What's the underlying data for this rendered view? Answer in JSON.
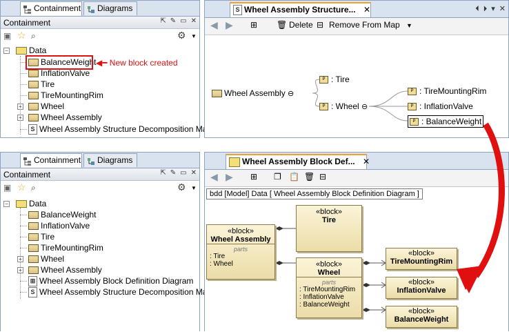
{
  "top": {
    "left_panel": {
      "tabs": [
        {
          "label": "Containment",
          "active": true
        },
        {
          "label": "Diagrams",
          "active": false
        }
      ],
      "title": "Containment",
      "tree_root": "Data",
      "tree_items": [
        {
          "label": "BalanceWeight",
          "kind": "block",
          "expandable": false
        },
        {
          "label": "InflationValve",
          "kind": "block",
          "expandable": false
        },
        {
          "label": "Tire",
          "kind": "block",
          "expandable": false
        },
        {
          "label": "TireMountingRim",
          "kind": "block",
          "expandable": false
        },
        {
          "label": "Wheel",
          "kind": "block",
          "expandable": true
        },
        {
          "label": "Wheel Assembly",
          "kind": "block",
          "expandable": true
        },
        {
          "label": "Wheel Assembly Structure Decomposition Map",
          "kind": "map",
          "expandable": false
        }
      ],
      "annotation": "New block created"
    },
    "right_panel": {
      "tab_label": "Wheel Assembly Structure...",
      "toolbar": {
        "delete_label": "Delete",
        "remove_label": "Remove From Map"
      },
      "map": {
        "root": "Wheel Assembly",
        "level1": [
          ": Tire",
          ": Wheel"
        ],
        "level2": [
          ": TireMountingRim",
          ": InflationValve",
          ": BalanceWeight"
        ]
      }
    }
  },
  "bottom": {
    "left_panel": {
      "tabs": [
        {
          "label": "Containment",
          "active": true
        },
        {
          "label": "Diagrams",
          "active": false
        }
      ],
      "title": "Containment",
      "tree_root": "Data",
      "tree_items": [
        {
          "label": "BalanceWeight",
          "kind": "block",
          "expandable": false
        },
        {
          "label": "InflationValve",
          "kind": "block",
          "expandable": false
        },
        {
          "label": "Tire",
          "kind": "block",
          "expandable": false
        },
        {
          "label": "TireMountingRim",
          "kind": "block",
          "expandable": false
        },
        {
          "label": "Wheel",
          "kind": "block",
          "expandable": true
        },
        {
          "label": "Wheel Assembly",
          "kind": "block",
          "expandable": true
        },
        {
          "label": "Wheel Assembly Block Definition Diagram",
          "kind": "bdd",
          "expandable": false
        },
        {
          "label": "Wheel Assembly Structure Decomposition Map",
          "kind": "map",
          "expandable": false
        }
      ]
    },
    "right_panel": {
      "tab_label": "Wheel Assembly Block Def...",
      "frame_label": "bdd [Model] Data [ Wheel Assembly Block Definition Diagram ]",
      "stereotype": "«block»",
      "parts_label": "parts",
      "blocks": {
        "wheel_assembly": {
          "name": "Wheel Assembly",
          "parts": [
            ": Tire",
            ": Wheel"
          ]
        },
        "tire": {
          "name": "Tire"
        },
        "wheel": {
          "name": "Wheel",
          "parts": [
            ": TireMountingRim",
            ": InflationValve",
            ": BalanceWeight"
          ]
        },
        "tire_mounting_rim": {
          "name": "TireMountingRim"
        },
        "inflation_valve": {
          "name": "InflationValve"
        },
        "balance_weight": {
          "name": "BalanceWeight"
        }
      }
    }
  },
  "colors": {
    "accent_red": "#dd1111",
    "tab_active_orange": "#f0a030",
    "block_fill": "#f3e6b8"
  }
}
